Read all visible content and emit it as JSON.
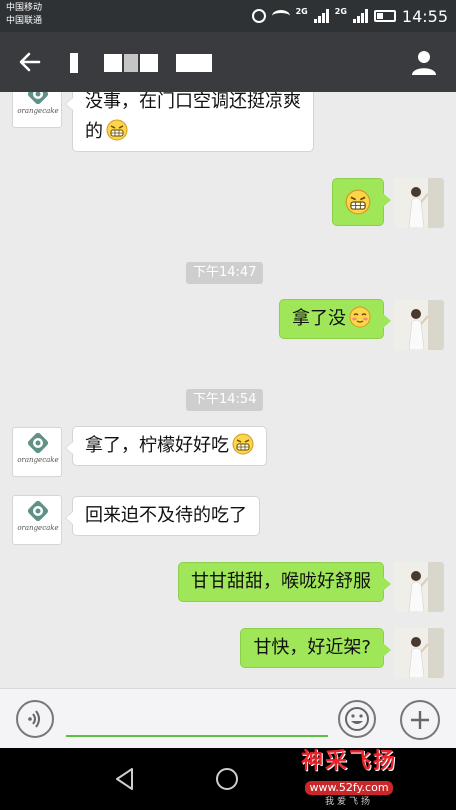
{
  "status_bar": {
    "carriers": [
      "中国移动",
      "中国联通"
    ],
    "network_badges": [
      "2G",
      "2G"
    ],
    "time": "14:55"
  },
  "title_bar": {
    "icons": [
      "back-arrow-icon",
      "person-icon"
    ]
  },
  "messages": [
    {
      "type": "text",
      "side": "left",
      "lines": [
        "没事，在门口空调还挺凉爽",
        "的"
      ],
      "emoji": "grin-emoji"
    },
    {
      "type": "text",
      "side": "right",
      "lines": [
        ""
      ],
      "emoji": "grin-emoji"
    },
    {
      "type": "time",
      "text": "下午14:47"
    },
    {
      "type": "text",
      "side": "right",
      "lines": [
        "拿了没"
      ],
      "emoji": "blush-emoji"
    },
    {
      "type": "time",
      "text": "下午14:54"
    },
    {
      "type": "text",
      "side": "left",
      "lines": [
        "拿了，柠檬好好吃"
      ],
      "emoji": "grin-emoji"
    },
    {
      "type": "text",
      "side": "left",
      "lines": [
        "回来迫不及待的吃了"
      ]
    },
    {
      "type": "text",
      "side": "right",
      "lines": [
        "甘甘甜甜，喉咙好舒服"
      ]
    },
    {
      "type": "text",
      "side": "right",
      "lines": [
        "甘快，好近架?"
      ]
    }
  ],
  "input_bar": {
    "value": "",
    "icons": [
      "voice-icon",
      "emoji-icon",
      "plus-icon"
    ]
  },
  "nav_bar": {
    "icons": [
      "back-triangle-icon",
      "home-circle-icon"
    ]
  },
  "watermark": {
    "logo": "神采飞扬",
    "url": "www.52fy.com",
    "tagline": "我爱飞扬"
  },
  "colors": {
    "status_bar": "#2e3235",
    "title_bar": "#393b3f",
    "chat_background": "#ebebeb",
    "outgoing_bubble": "#9fe658",
    "incoming_bubble": "#ffffff",
    "input_underline": "#5fbd43",
    "watermark_red": "#e8232a"
  }
}
